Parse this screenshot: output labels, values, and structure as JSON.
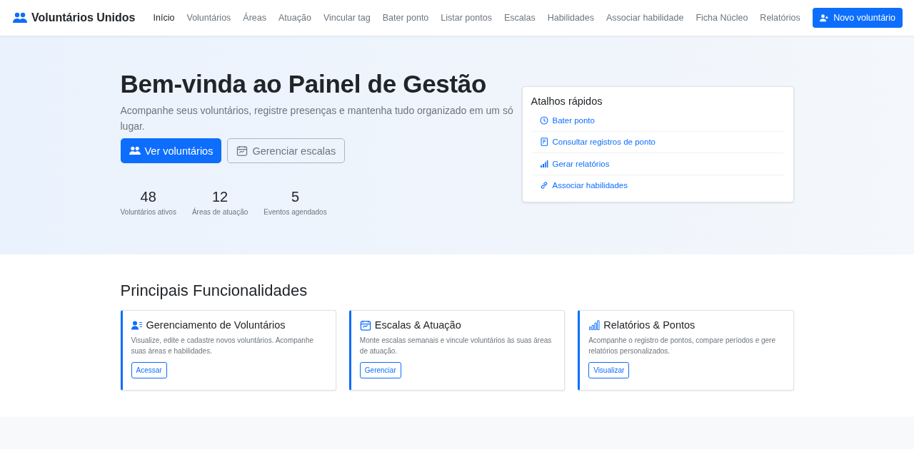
{
  "brand": {
    "name": "Voluntários Unidos"
  },
  "nav": [
    {
      "label": "Início",
      "selected": true
    },
    {
      "label": "Voluntários",
      "selected": false
    },
    {
      "label": "Áreas",
      "selected": false
    },
    {
      "label": "Atuação",
      "selected": false
    },
    {
      "label": "Vincular tag",
      "selected": false
    },
    {
      "label": "Bater ponto",
      "selected": false
    },
    {
      "label": "Listar pontos",
      "selected": false
    },
    {
      "label": "Escalas",
      "selected": false
    },
    {
      "label": "Habilidades",
      "selected": false
    },
    {
      "label": "Associar habilidade",
      "selected": false
    },
    {
      "label": "Ficha Núcleo",
      "selected": false
    },
    {
      "label": "Relatórios",
      "selected": false
    }
  ],
  "nav_button": "Novo voluntário",
  "hero": {
    "title": "Bem-vinda ao Painel de Gestão",
    "subtitle": "Acompanhe seus voluntários, registre presenças e mantenha tudo organizado em um só lugar.",
    "primary_button": "Ver voluntários",
    "secondary_button": "Gerenciar escalas",
    "stats": [
      {
        "value": "48",
        "label": "Voluntários ativos"
      },
      {
        "value": "12",
        "label": "Áreas de atuação"
      },
      {
        "value": "5",
        "label": "Eventos agendados"
      }
    ]
  },
  "shortcuts": {
    "title": "Atalhos rápidos",
    "items": [
      {
        "kind": "clock",
        "label": "Bater ponto"
      },
      {
        "kind": "document",
        "label": "Consultar registros de ponto"
      },
      {
        "kind": "chart",
        "label": "Gerar relatórios"
      },
      {
        "kind": "link",
        "label": "Associar habilidades"
      }
    ]
  },
  "features": {
    "title": "Principais Funcionalidades",
    "cards": [
      {
        "kind": "users",
        "title": "Gerenciamento de Voluntários",
        "text": "Visualize, edite e cadastre novos voluntários. Acompanhe suas áreas e habilidades.",
        "button": "Acessar"
      },
      {
        "kind": "calendar",
        "title": "Escalas & Atuação",
        "text": "Monte escalas semanais e vincule voluntários às suas áreas de atuação.",
        "button": "Gerenciar"
      },
      {
        "kind": "chart",
        "title": "Relatórios & Pontos",
        "text": "Acompanhe o registro de pontos, compare períodos e gere relatórios personalizados.",
        "button": "Visualizar"
      }
    ]
  }
}
